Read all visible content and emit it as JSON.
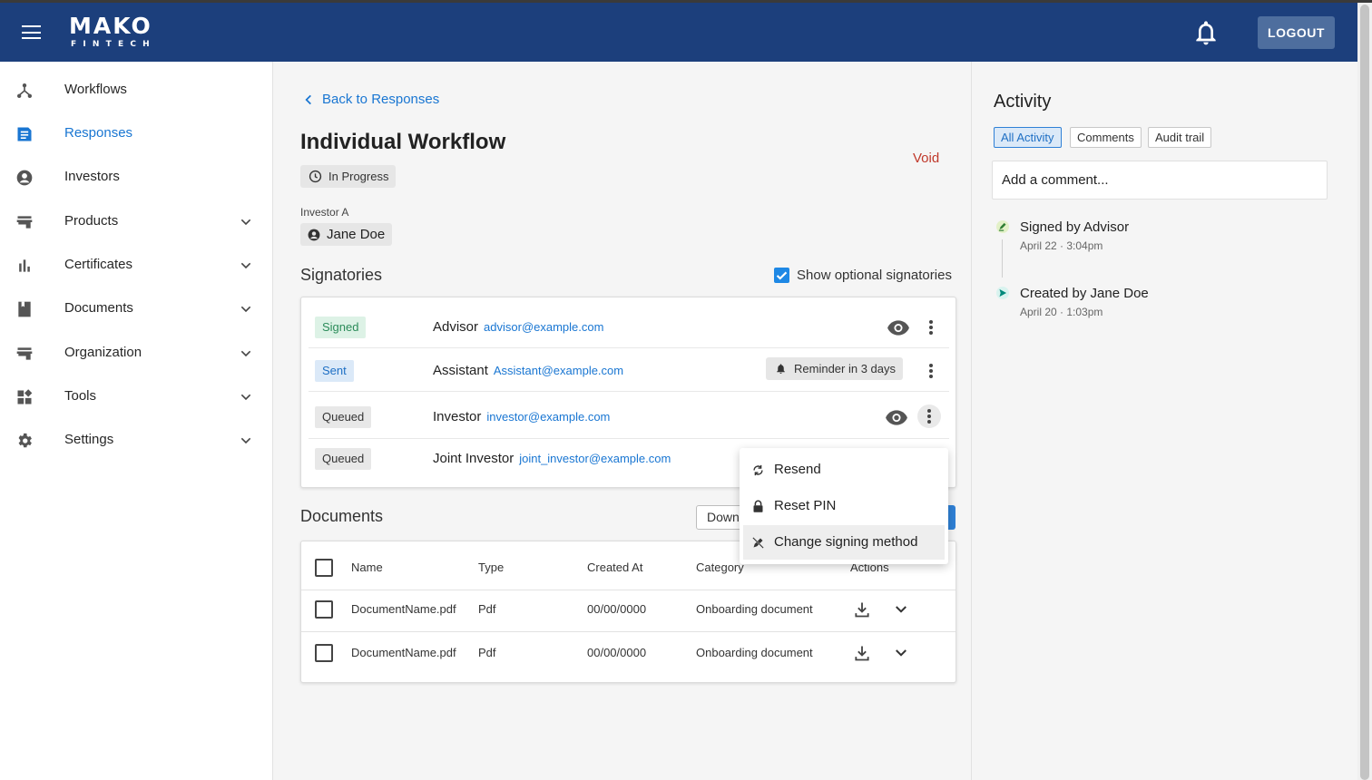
{
  "app": {
    "logo_line1": "MAKO",
    "logo_line2": "FINTECH",
    "logout_label": "LOGOUT",
    "brand_color": "#1c3f7c",
    "accent_color": "#1976d2"
  },
  "sidebar": {
    "items": [
      {
        "label": "Workflows",
        "icon": "workflow-icon",
        "active": false,
        "expandable": false
      },
      {
        "label": "Responses",
        "icon": "document-icon",
        "active": true,
        "expandable": false
      },
      {
        "label": "Investors",
        "icon": "user-circle-icon",
        "active": false,
        "expandable": false
      },
      {
        "label": "Products",
        "icon": "store-icon",
        "active": false,
        "expandable": true
      },
      {
        "label": "Certificates",
        "icon": "bar-chart-icon",
        "active": false,
        "expandable": true
      },
      {
        "label": "Documents",
        "icon": "book-icon",
        "active": false,
        "expandable": true
      },
      {
        "label": "Organization",
        "icon": "store-icon",
        "active": false,
        "expandable": true
      },
      {
        "label": "Tools",
        "icon": "widgets-icon",
        "active": false,
        "expandable": true
      },
      {
        "label": "Settings",
        "icon": "gear-icon",
        "active": false,
        "expandable": true
      }
    ]
  },
  "main": {
    "back_label": "Back to Responses",
    "title": "Individual Workflow",
    "void_label": "Void",
    "status": "In Progress",
    "investor_label": "Investor A",
    "investor_name": "Jane Doe",
    "signatories_title": "Signatories",
    "show_optional_label": "Show optional signatories",
    "show_optional_checked": true,
    "signatories": [
      {
        "status": "Signed",
        "role": "Advisor",
        "email": "advisor@example.com"
      },
      {
        "status": "Sent",
        "role": "Assistant",
        "email": "Assistant@example.com",
        "reminder": "Reminder in 3 days"
      },
      {
        "status": "Queued",
        "role": "Investor",
        "email": "investor@example.com"
      },
      {
        "status": "Queued",
        "role": "Joint Investor",
        "email": "joint_investor@example.com"
      }
    ],
    "documents_title": "Documents",
    "download_label_partial": "Down",
    "documents_table": {
      "columns": [
        "Name",
        "Type",
        "Created At",
        "Category",
        "Actions"
      ],
      "rows": [
        {
          "name": "DocumentName.pdf",
          "type": "Pdf",
          "created_at": "00/00/0000",
          "category": "Onboarding document"
        },
        {
          "name": "DocumentName.pdf",
          "type": "Pdf",
          "created_at": "00/00/0000",
          "category": "Onboarding document"
        }
      ]
    }
  },
  "context_menu": {
    "items": [
      {
        "label": "Resend",
        "icon": "refresh-icon"
      },
      {
        "label": "Reset PIN",
        "icon": "lock-icon"
      },
      {
        "label": "Change signing method",
        "icon": "edit-off-icon",
        "highlighted": true
      }
    ]
  },
  "activity": {
    "title": "Activity",
    "tabs": [
      "All Activity",
      "Comments",
      "Audit trail"
    ],
    "active_tab": "All Activity",
    "comment_placeholder": "Add a comment...",
    "events": [
      {
        "title": "Signed by Advisor",
        "date": "April 22",
        "time": "3:04pm",
        "icon": "signature-icon"
      },
      {
        "title": "Created by Jane Doe",
        "date": "April 20",
        "time": "1:03pm",
        "icon": "send-icon"
      }
    ]
  }
}
